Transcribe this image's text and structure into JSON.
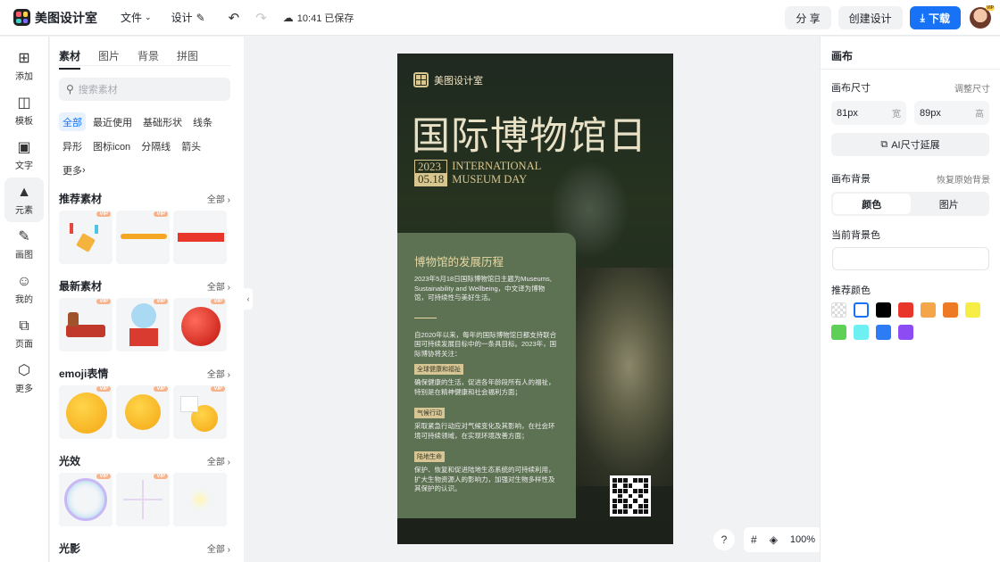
{
  "topbar": {
    "app_name": "美图设计室",
    "file_menu": "文件",
    "design_menu": "设计",
    "saved_status": "10:41 已保存",
    "share_label": "分 享",
    "create_label": "创建设计",
    "download_label": "下载",
    "avatar_badge": "VIP"
  },
  "leftnav": [
    {
      "icon": "add-icon",
      "label": "添加"
    },
    {
      "icon": "template-icon",
      "label": "模板"
    },
    {
      "icon": "text-icon",
      "label": "文字"
    },
    {
      "icon": "element-icon",
      "label": "元素"
    },
    {
      "icon": "draw-icon",
      "label": "画图"
    },
    {
      "icon": "user-icon",
      "label": "我的"
    },
    {
      "icon": "page-icon",
      "label": "页面"
    },
    {
      "icon": "more-icon",
      "label": "更多"
    }
  ],
  "panel": {
    "tabs": [
      "素材",
      "图片",
      "背景",
      "拼图"
    ],
    "search_placeholder": "搜索素材",
    "chips": [
      "全部",
      "最近使用",
      "基础形状",
      "线条",
      "异形",
      "图标icon",
      "分隔线",
      "箭头",
      "更多"
    ],
    "more_label": "全部",
    "vip_badge": "VIP",
    "sections": [
      {
        "title": "推荐素材"
      },
      {
        "title": "最新素材"
      },
      {
        "title": "emoji表情"
      },
      {
        "title": "光效"
      },
      {
        "title": "光影"
      }
    ]
  },
  "poster": {
    "brand": "美图设计室",
    "title": "国际博物馆日",
    "year": "2023",
    "date": "05.18",
    "en_line1": "INTERNATIONAL",
    "en_line2": "MUSEUM DAY",
    "section_title": "博物馆的发展历程",
    "para1": "2023年5月18日国际博物馆日主题为Museums, Sustainability and Wellbeing，中文译为博物馆，可持续性与美好生活。",
    "para2": "自2020年以来，每年的国际博物馆日都支持联合国可持续发展目标中的一条具目标。2023年，国际博协将关注：",
    "tag1": "全球健康和福祉",
    "tag1_text": "确保健康的生活，促进各年龄段所有人的福祉，特别是在精神健康和社会福利方面；",
    "tag2": "气候行动",
    "tag2_text": "采取紧急行动应对气候变化及其影响，在社会环境可持续领域，在实现环境改善方面；",
    "tag3": "陆地生命",
    "tag3_text": "保护、恢复和促进陆地生态系统的可持续利用，扩大生物资源人的影响力，加强对生物多样性及其保护的认识。"
  },
  "zoom": {
    "help": "?",
    "grid_icon": "grid-icon",
    "layers_icon": "layers-icon",
    "level": "100%"
  },
  "rpanel": {
    "title": "画布",
    "size_label": "画布尺寸",
    "size_link": "调整尺寸",
    "width_value": "81px",
    "width_unit": "宽",
    "height_value": "89px",
    "height_unit": "高",
    "ai_label": "AI尺寸延展",
    "bg_label": "画布背景",
    "bg_link": "恢复原始背景",
    "seg_color": "颜色",
    "seg_image": "图片",
    "current_bg_label": "当前背景色",
    "rec_label": "推荐颜色",
    "colors": [
      "transparent",
      "#ffffff",
      "#000000",
      "#e8372a",
      "#f5a54a",
      "#ee7a26",
      "#f7ee45",
      "#5dd055",
      "#6ef0f3",
      "#2d7cf6",
      "#8d4cf3"
    ]
  }
}
